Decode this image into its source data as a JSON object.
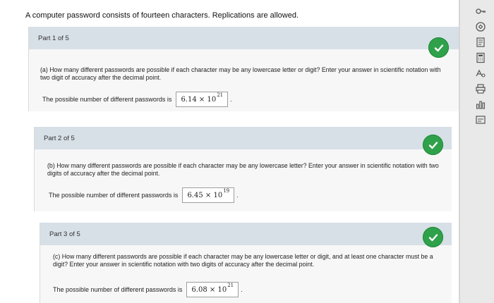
{
  "problem": {
    "statement": "A computer password consists of fourteen characters. Replications are allowed."
  },
  "parts": [
    {
      "title": "Part 1 of 5",
      "question": "(a) How many different passwords are possible if each character may be any lowercase letter or digit? Enter your answer in scientific notation with two digit of accuracy after the decimal point.",
      "answer_label": "The possible number of different passwords is",
      "mantissa": "6.14",
      "times": "×",
      "base": "10",
      "exponent": "21",
      "period": ".",
      "status": "correct"
    },
    {
      "title": "Part 2 of 5",
      "question": "(b) How many different passwords are possible if each character may be any lowercase letter? Enter your answer in scientific notation with two digits of accuracy after the decimal point.",
      "answer_label": "The possible number of different passwords is",
      "mantissa": "6.45",
      "times": "×",
      "base": "10",
      "exponent": "19",
      "period": ".",
      "status": "correct"
    },
    {
      "title": "Part 3 of 5",
      "question": "(c) How many different passwords are possible if each character may be any lowercase letter or digit, and at least one character must be a digit? Enter your answer in scientific notation with two digits of accuracy after the decimal point.",
      "answer_label": "The possible number of different passwords is",
      "mantissa": "6.08",
      "times": "×",
      "base": "10",
      "exponent": "21",
      "period": ".",
      "status": "correct"
    }
  ],
  "toolbar": {
    "icons": [
      "key-icon",
      "settings-icon",
      "notes-icon",
      "calculator-icon",
      "glossary-icon",
      "print-icon",
      "chart-icon",
      "gallery-icon"
    ]
  },
  "colors": {
    "header_bg": "#d7dfe7",
    "check_green": "#2fa14a"
  }
}
